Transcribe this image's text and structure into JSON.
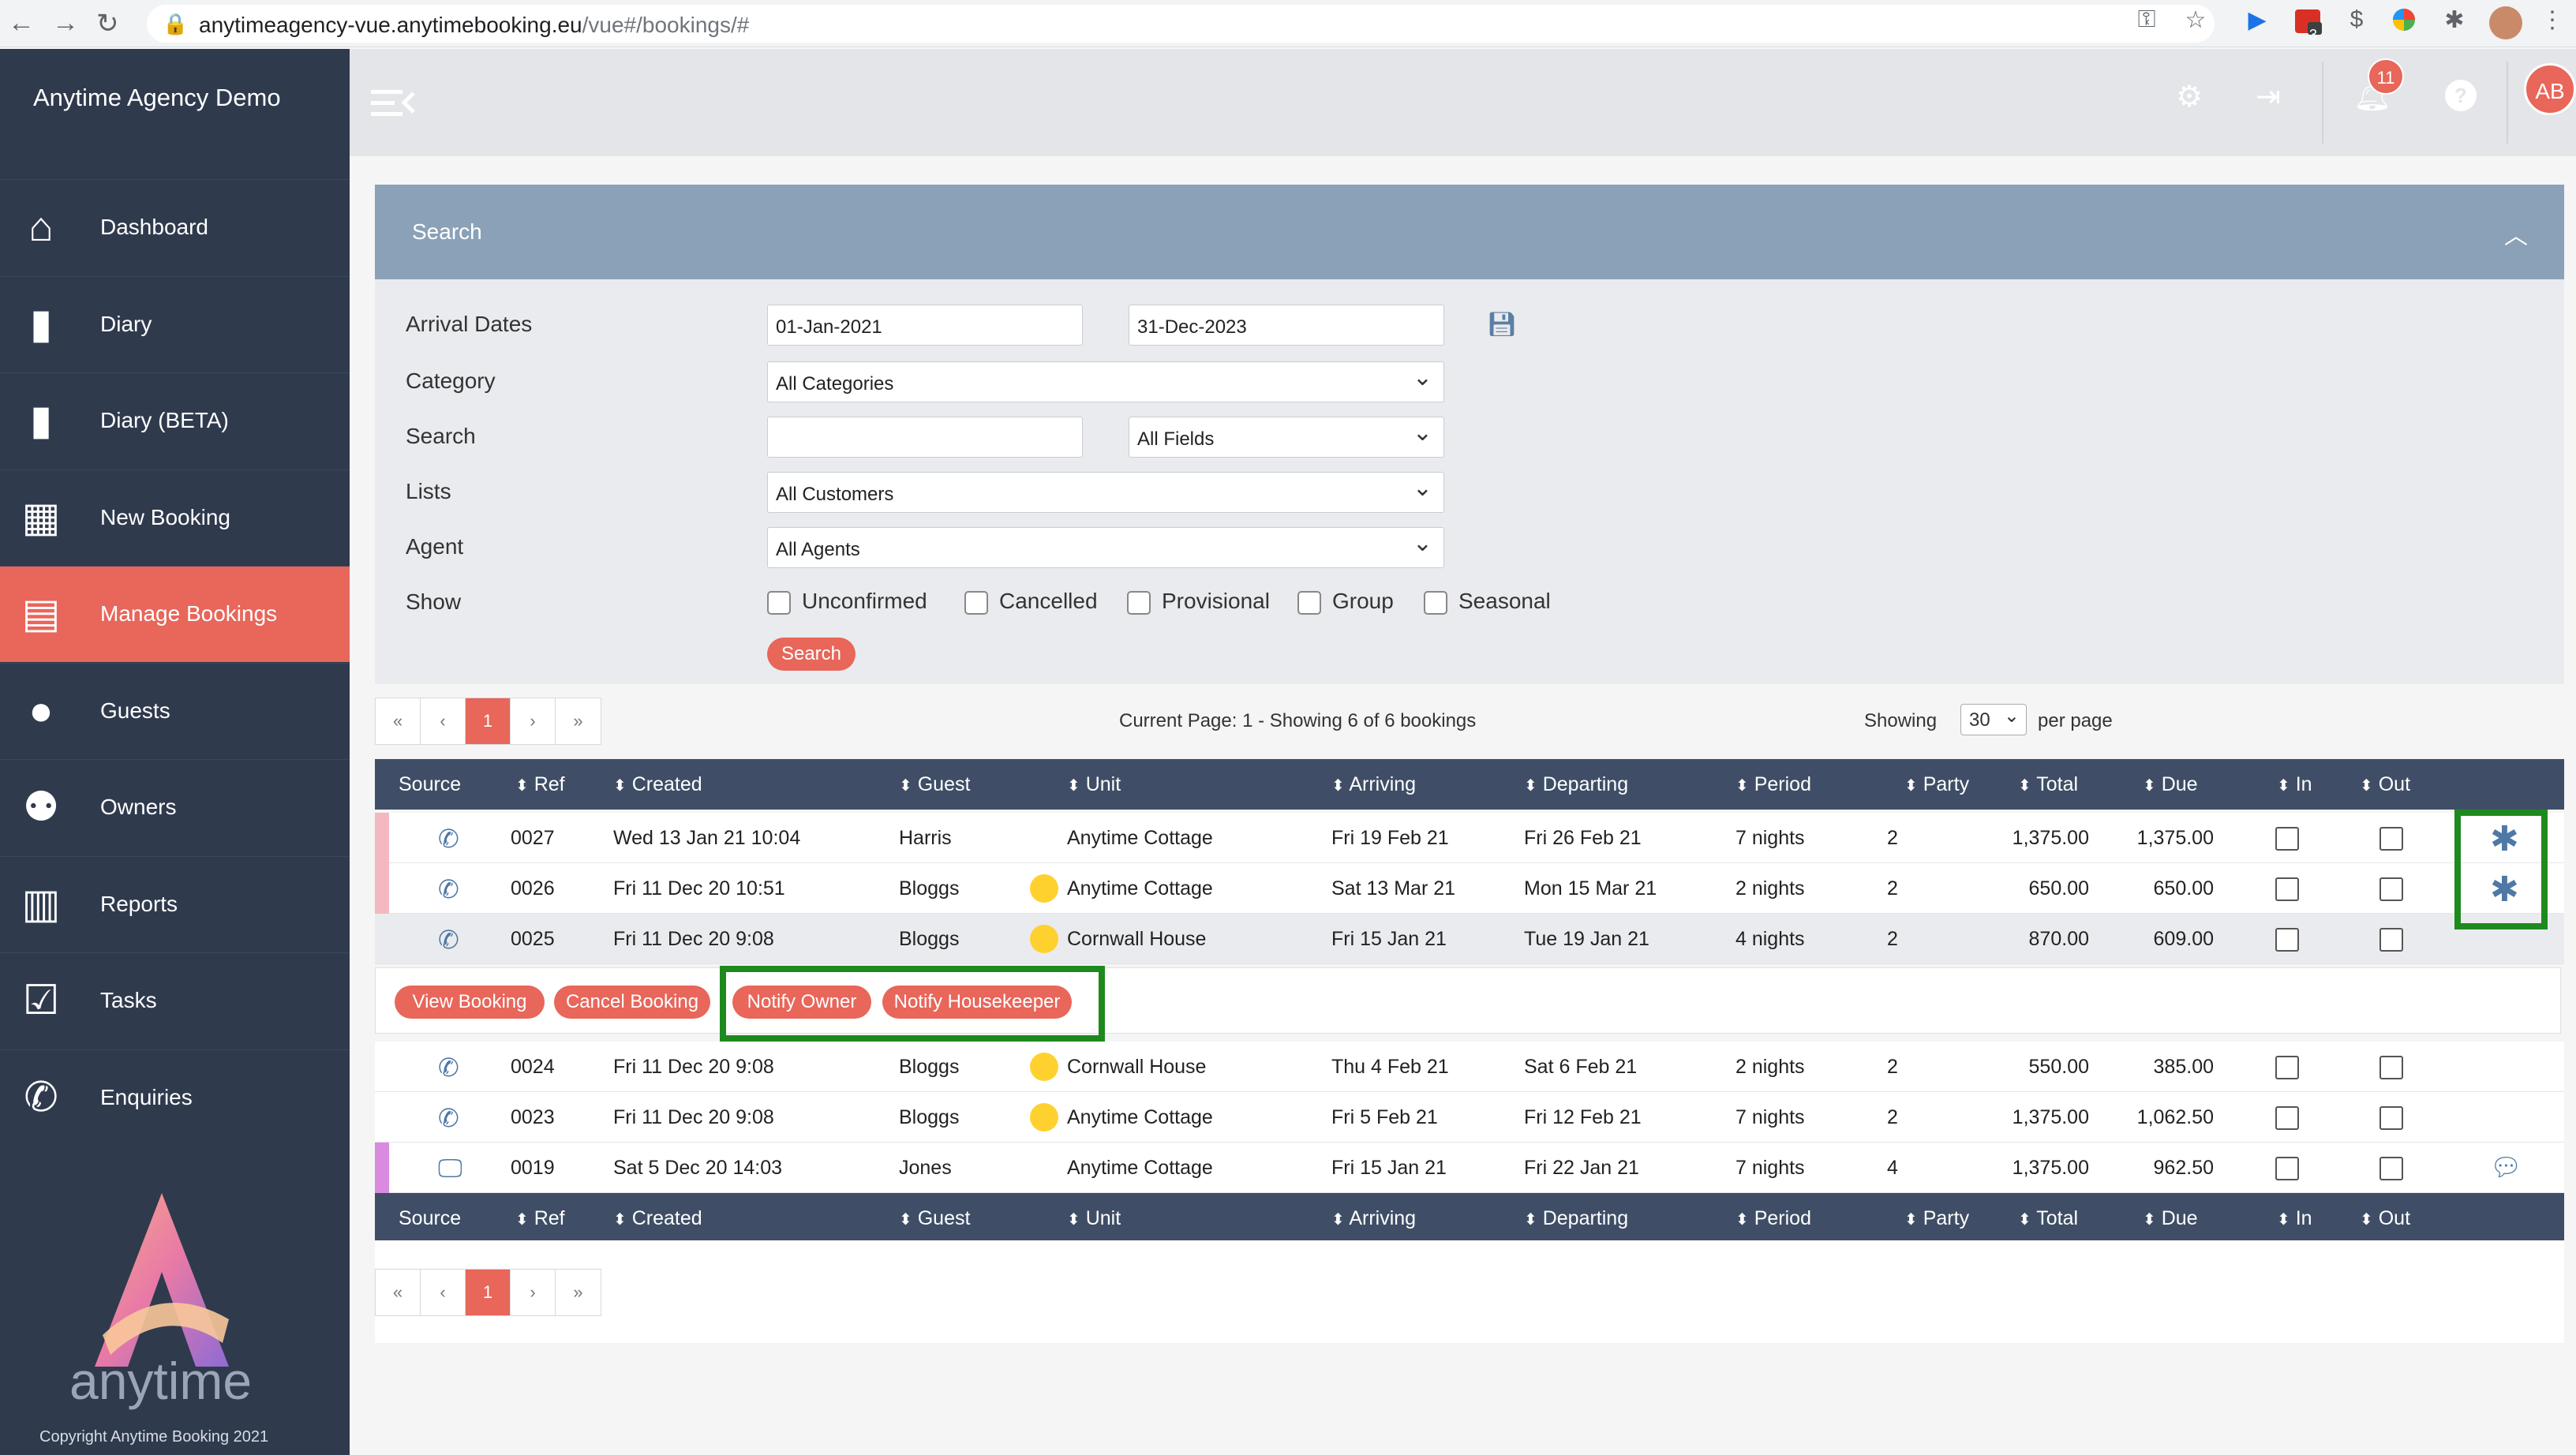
{
  "browser": {
    "url_host": "anytimeagency-vue.anytimebooking.eu",
    "url_path": "/vue#/bookings/#",
    "ext_badge": "3"
  },
  "app": {
    "brand": "Anytime Agency Demo",
    "logo_word": "anytime",
    "copyright": "Copyright Anytime Booking 2021",
    "notification_count": "11",
    "avatar_initials": "AB"
  },
  "sidebar": {
    "items": [
      {
        "label": "Dashboard",
        "icon": "home-icon"
      },
      {
        "label": "Diary",
        "icon": "book-icon"
      },
      {
        "label": "Diary (BETA)",
        "icon": "book-icon"
      },
      {
        "label": "New Booking",
        "icon": "calendar-day-icon"
      },
      {
        "label": "Manage Bookings",
        "icon": "calendar-icon"
      },
      {
        "label": "Guests",
        "icon": "user-circle-icon"
      },
      {
        "label": "Owners",
        "icon": "users-icon"
      },
      {
        "label": "Reports",
        "icon": "bar-chart-icon"
      },
      {
        "label": "Tasks",
        "icon": "check-square-icon"
      },
      {
        "label": "Enquiries",
        "icon": "phone-incoming-icon"
      }
    ]
  },
  "search": {
    "title": "Search",
    "labels": {
      "arrival": "Arrival Dates",
      "category": "Category",
      "search": "Search",
      "lists": "Lists",
      "agent": "Agent",
      "show": "Show"
    },
    "arrival_from": "01-Jan-2021",
    "arrival_to": "31-Dec-2023",
    "category": "All Categories",
    "search_text": "",
    "fields": "All Fields",
    "lists": "All Customers",
    "agent": "All Agents",
    "show_options": [
      "Unconfirmed",
      "Cancelled",
      "Provisional",
      "Group",
      "Seasonal"
    ],
    "search_button": "Search"
  },
  "pagination": {
    "first": "«",
    "prev": "‹",
    "current": "1",
    "next": "›",
    "last": "»",
    "info": "Current Page: 1 - Showing 6 of 6 bookings",
    "showing_label": "Showing",
    "per_page_value": "30",
    "per_page_label": "per page"
  },
  "table": {
    "columns": [
      "Source",
      "Ref",
      "Created",
      "Guest",
      "Unit",
      "Arriving",
      "Departing",
      "Period",
      "Party",
      "Total",
      "Due",
      "In",
      "Out"
    ],
    "rows": [
      {
        "source": "phone-icon",
        "ref": "0027",
        "created": "Wed 13 Jan 21 10:04",
        "guest": "Harris",
        "unit": "Anytime Cottage",
        "arriving": "Fri 19 Feb 21",
        "departing": "Fri 26 Feb 21",
        "period": "7 nights",
        "party": "2",
        "total": "1,375.00",
        "due": "1,375.00",
        "strip": "#f4b9c0",
        "dot": false,
        "action": "asterisk-icon"
      },
      {
        "source": "phone-icon",
        "ref": "0026",
        "created": "Fri 11 Dec 20 10:51",
        "guest": "Bloggs",
        "unit": "Anytime Cottage",
        "arriving": "Sat 13 Mar 21",
        "departing": "Mon 15 Mar 21",
        "period": "2 nights",
        "party": "2",
        "total": "650.00",
        "due": "650.00",
        "strip": "#f4b9c0",
        "dot": true,
        "action": "asterisk-icon"
      },
      {
        "source": "phone-icon",
        "ref": "0025",
        "created": "Fri 11 Dec 20 9:08",
        "guest": "Bloggs",
        "unit": "Cornwall House",
        "arriving": "Fri 15 Jan 21",
        "departing": "Tue 19 Jan 21",
        "period": "4 nights",
        "party": "2",
        "total": "870.00",
        "due": "609.00",
        "strip": "",
        "dot": true,
        "action": ""
      },
      {
        "source": "phone-icon",
        "ref": "0024",
        "created": "Fri 11 Dec 20 9:08",
        "guest": "Bloggs",
        "unit": "Cornwall House",
        "arriving": "Thu 4 Feb 21",
        "departing": "Sat 6 Feb 21",
        "period": "2 nights",
        "party": "2",
        "total": "550.00",
        "due": "385.00",
        "strip": "",
        "dot": true,
        "action": ""
      },
      {
        "source": "phone-icon",
        "ref": "0023",
        "created": "Fri 11 Dec 20 9:08",
        "guest": "Bloggs",
        "unit": "Anytime Cottage",
        "arriving": "Fri 5 Feb 21",
        "departing": "Fri 12 Feb 21",
        "period": "7 nights",
        "party": "2",
        "total": "1,375.00",
        "due": "1,062.50",
        "strip": "",
        "dot": true,
        "action": ""
      },
      {
        "source": "monitor-icon",
        "ref": "0019",
        "created": "Sat 5 Dec 20 14:03",
        "guest": "Jones",
        "unit": "Anytime Cottage",
        "arriving": "Fri 15 Jan 21",
        "departing": "Fri 22 Jan 21",
        "period": "7 nights",
        "party": "4",
        "total": "1,375.00",
        "due": "962.50",
        "strip": "#d98be0",
        "dot": false,
        "action": "comments-icon"
      }
    ],
    "row_actions": [
      "View Booking",
      "Cancel Booking",
      "Notify Owner",
      "Notify Housekeeper"
    ]
  },
  "colors": {
    "accent": "#e8665a",
    "sidebar": "#2f3a4d",
    "table_header": "#3f4e66",
    "search_header": "#8aa1b8",
    "highlight": "#1e8a1e"
  }
}
